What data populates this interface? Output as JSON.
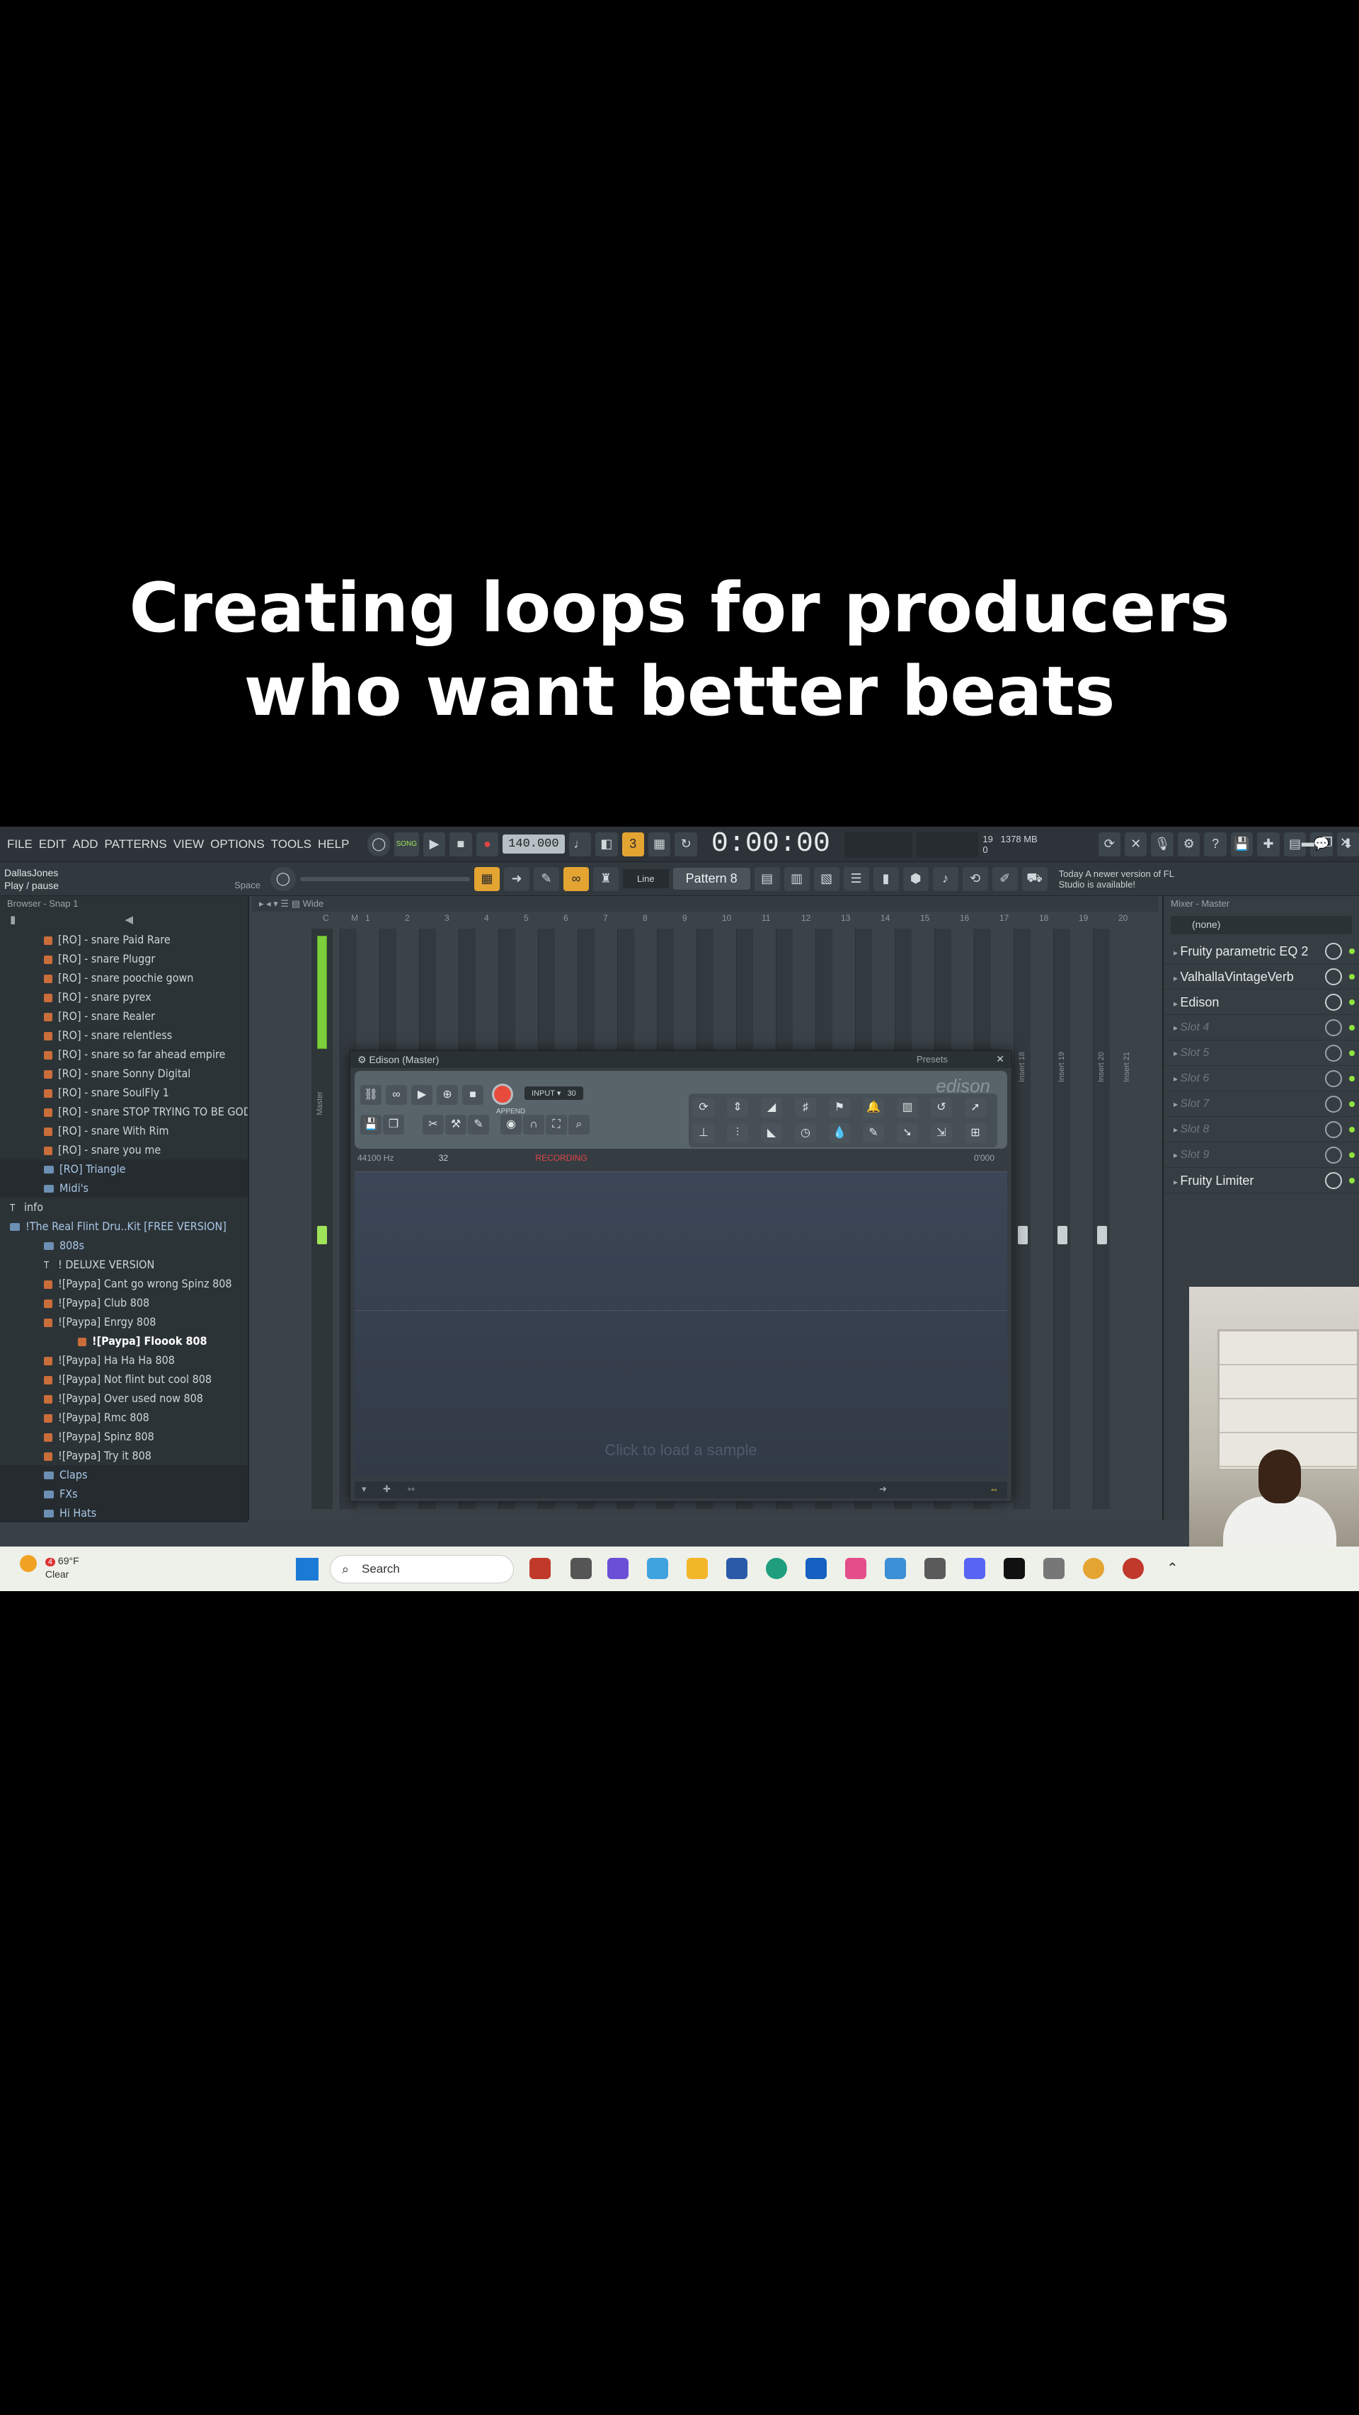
{
  "caption": {
    "line1": "Creating loops for producers",
    "line2": "who want better beats"
  },
  "menu": [
    "FILE",
    "EDIT",
    "ADD",
    "PATTERNS",
    "VIEW",
    "OPTIONS",
    "TOOLS",
    "HELP"
  ],
  "transport": {
    "song_label": "SONG",
    "tempo": "140.000",
    "time": "0:00:00",
    "cpu": "19",
    "ram": "1378 MB",
    "voices": "0"
  },
  "hint": {
    "user": "DallasJones",
    "text": "Play / pause",
    "shortcut": "Space"
  },
  "toolbar2": {
    "snap": "Line",
    "pattern": "Pattern 8",
    "news": "Today  A newer version of FL Studio is available!"
  },
  "browser": {
    "header": "Browser - Snap 1",
    "items": [
      {
        "label": "[RO] - snare Paid Rare",
        "kind": "audio",
        "indent": 1
      },
      {
        "label": "[RO] - snare Pluggr",
        "kind": "audio",
        "indent": 1
      },
      {
        "label": "[RO] - snare poochie gown",
        "kind": "audio",
        "indent": 1
      },
      {
        "label": "[RO] - snare pyrex",
        "kind": "audio",
        "indent": 1
      },
      {
        "label": "[RO] - snare Realer",
        "kind": "audio",
        "indent": 1
      },
      {
        "label": "[RO] - snare relentless",
        "kind": "audio",
        "indent": 1
      },
      {
        "label": "[RO] - snare so far ahead empire",
        "kind": "audio",
        "indent": 1
      },
      {
        "label": "[RO] - snare Sonny Digital",
        "kind": "audio",
        "indent": 1
      },
      {
        "label": "[RO] - snare SoulFly 1",
        "kind": "audio",
        "indent": 1
      },
      {
        "label": "[RO] - snare STOP TRYING TO BE GOD",
        "kind": "audio",
        "indent": 1
      },
      {
        "label": "[RO] - snare With Rim",
        "kind": "audio",
        "indent": 1
      },
      {
        "label": "[RO] - snare you me",
        "kind": "audio",
        "indent": 1
      },
      {
        "label": "[RO] Triangle",
        "kind": "folder",
        "indent": 1,
        "dark": true
      },
      {
        "label": "Midi's",
        "kind": "folder",
        "indent": 1,
        "dark": true
      },
      {
        "label": "info",
        "kind": "text",
        "indent": 0
      },
      {
        "label": "!The Real Flint Dru..Kit [FREE VERSION]",
        "kind": "folder",
        "indent": 0
      },
      {
        "label": "808s",
        "kind": "folder",
        "indent": 1
      },
      {
        "label": "! DELUXE VERSION",
        "kind": "text",
        "indent": 1
      },
      {
        "label": "![Paypa] Cant go wrong Spinz 808",
        "kind": "audio",
        "indent": 1
      },
      {
        "label": "![Paypa] Club 808",
        "kind": "audio",
        "indent": 1
      },
      {
        "label": "![Paypa] Enrgy 808",
        "kind": "audio",
        "indent": 1
      },
      {
        "label": "![Paypa] Floook 808",
        "kind": "audio",
        "indent": 2,
        "selected": true
      },
      {
        "label": "![Paypa] Ha Ha Ha 808",
        "kind": "audio",
        "indent": 1
      },
      {
        "label": "![Paypa] Not flint but cool 808",
        "kind": "audio",
        "indent": 1
      },
      {
        "label": "![Paypa] Over used now 808",
        "kind": "audio",
        "indent": 1
      },
      {
        "label": "![Paypa] Rmc 808",
        "kind": "audio",
        "indent": 1
      },
      {
        "label": "![Paypa] Spinz 808",
        "kind": "audio",
        "indent": 1
      },
      {
        "label": "![Paypa] Try it 808",
        "kind": "audio",
        "indent": 1
      },
      {
        "label": "Claps",
        "kind": "folder",
        "indent": 1,
        "dark": true
      },
      {
        "label": "FXs",
        "kind": "folder",
        "indent": 1,
        "dark": true
      },
      {
        "label": "Hi Hats",
        "kind": "folder",
        "indent": 1,
        "dark": true
      }
    ]
  },
  "mixer": {
    "header": "Wide",
    "ruler": [
      "C",
      "M",
      "1",
      "2",
      "3",
      "4",
      "5",
      "6",
      "7",
      "8",
      "9",
      "10",
      "11",
      "12",
      "13",
      "14",
      "15",
      "16",
      "17",
      "18",
      "19",
      "20"
    ],
    "master_label": "Master",
    "insert_labels": [
      "Insert 18",
      "Insert 19",
      "Insert 20",
      "Insert 21"
    ]
  },
  "edison": {
    "title": "Edison (Master)",
    "presets": "Presets",
    "logo": "edison",
    "input": "INPUT",
    "input_val": "30",
    "append": "APPEND",
    "info_left": "44100 Hz",
    "info_num": "32",
    "recording": "RECORDING",
    "info_right": "0'000",
    "placeholder": "Click to load a sample"
  },
  "plugins": {
    "header": "Mixer - Master",
    "selected": "(none)",
    "slots": [
      {
        "label": "Fruity parametric EQ 2",
        "empty": false
      },
      {
        "label": "ValhallaVintageVerb",
        "empty": false
      },
      {
        "label": "Edison",
        "empty": false
      },
      {
        "label": "Slot 4",
        "empty": true
      },
      {
        "label": "Slot 5",
        "empty": true
      },
      {
        "label": "Slot 6",
        "empty": true
      },
      {
        "label": "Slot 7",
        "empty": true
      },
      {
        "label": "Slot 8",
        "empty": true
      },
      {
        "label": "Slot 9",
        "empty": true
      },
      {
        "label": "Fruity Limiter",
        "empty": false
      }
    ]
  },
  "taskbar": {
    "badge": "4",
    "temperature": "69°F",
    "condition": "Clear",
    "search": "Search",
    "colors": {
      "start": "#1b7ad6",
      "accent": "#e3a432",
      "meter": "#7ccf3a"
    }
  }
}
